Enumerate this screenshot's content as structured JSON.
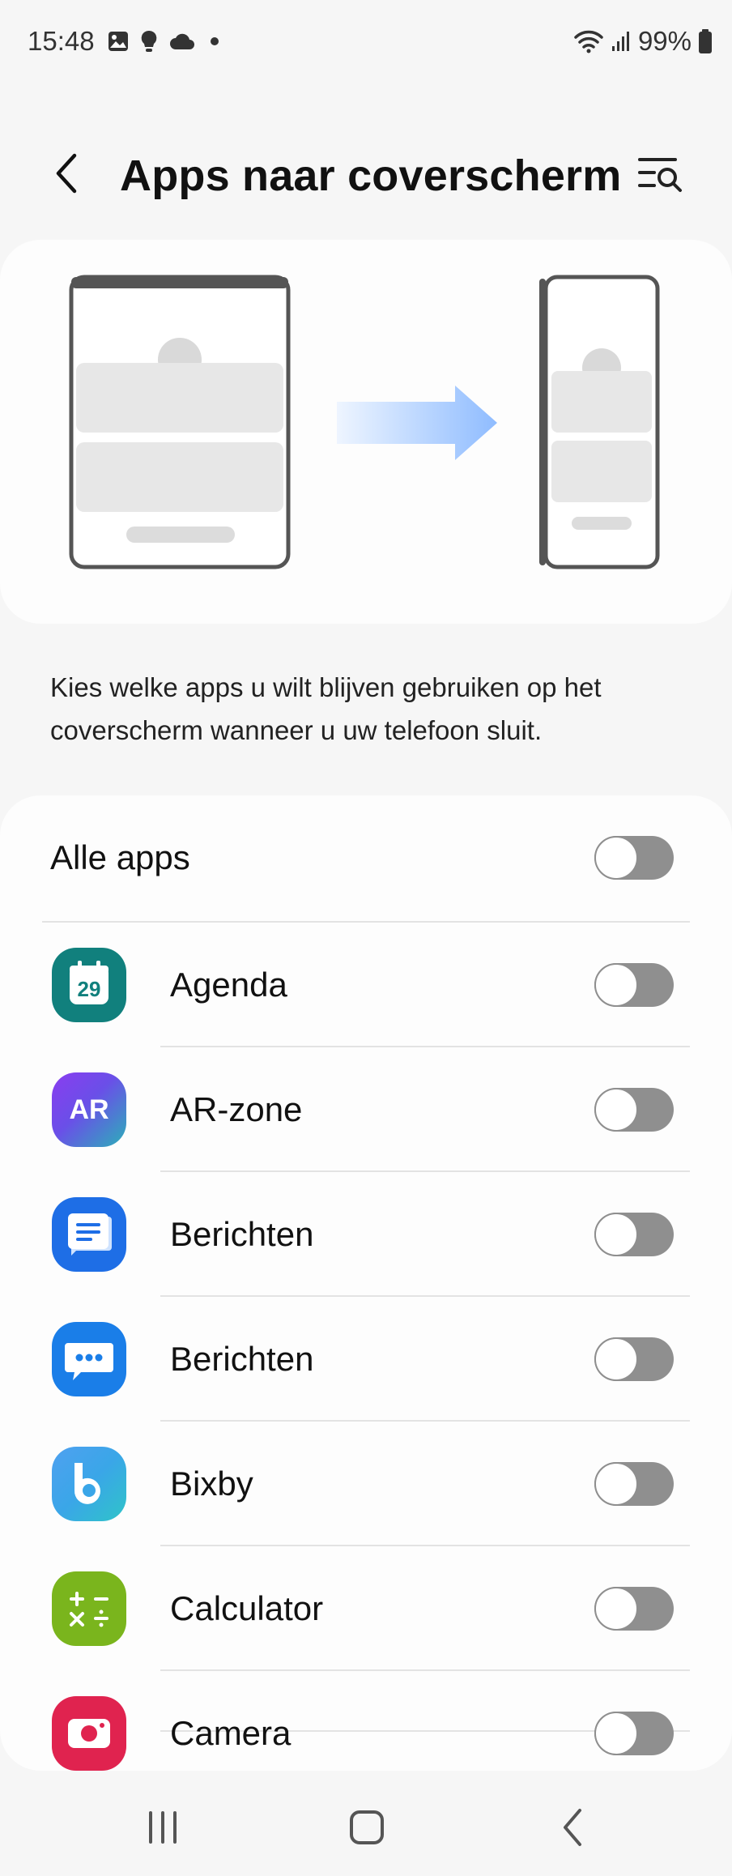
{
  "status_bar": {
    "time": "15:48",
    "left_icons": [
      "gallery-icon",
      "bulb-icon",
      "cloud-icon",
      "dot-icon"
    ],
    "right_icons": [
      "wifi-icon",
      "signal-icon",
      "battery-icon"
    ],
    "battery": "99%"
  },
  "header": {
    "title": "Apps naar coverscherm",
    "back_icon": "chevron-left-icon",
    "search_icon": "list-search-icon"
  },
  "illustration": {
    "from": "unfolded-phone",
    "to": "cover-screen",
    "arrow_color": "#8fbcff"
  },
  "description": "Kies welke apps u wilt blijven gebruiken op het coverscherm wanneer u uw telefoon sluit.",
  "all_apps": {
    "label": "Alle apps",
    "enabled": false
  },
  "apps": [
    {
      "label": "Agenda",
      "icon": "calendar-icon",
      "icon_text": "29",
      "enabled": false
    },
    {
      "label": "AR-zone",
      "icon": "ar-zone-icon",
      "icon_text": "AR",
      "enabled": false
    },
    {
      "label": "Berichten",
      "icon": "google-messages-icon",
      "enabled": false
    },
    {
      "label": "Berichten",
      "icon": "samsung-messages-icon",
      "enabled": false
    },
    {
      "label": "Bixby",
      "icon": "bixby-icon",
      "enabled": false
    },
    {
      "label": "Calculator",
      "icon": "calculator-icon",
      "enabled": false
    },
    {
      "label": "Camera",
      "icon": "camera-icon",
      "enabled": false
    }
  ],
  "colors": {
    "background": "#f6f6f6",
    "card": "#fdfdfd",
    "toggle_off": "#8f8f8f",
    "agenda": "#11807d",
    "berichten_google": "#1e6ee6",
    "berichten_samsung": "#1a7ee8",
    "calculator": "#7ab51d",
    "camera": "#e0234f"
  },
  "nav_bar": {
    "recents_icon": "recents-icon",
    "home_icon": "home-icon",
    "back_icon": "back-icon"
  }
}
